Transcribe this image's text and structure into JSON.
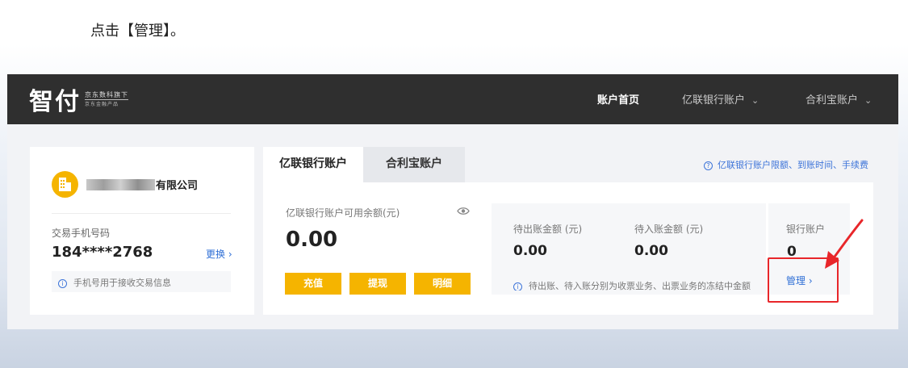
{
  "instruction": "点击【管理】。",
  "header": {
    "logo_main": "智付",
    "logo_sub_line1": "京东数科旗下",
    "logo_sub_line2": "京东金融产品",
    "nav": [
      {
        "label": "账户首页",
        "active": true
      },
      {
        "label": "亿联银行账户",
        "has_dropdown": true
      },
      {
        "label": "合利宝账户",
        "has_dropdown": true
      }
    ]
  },
  "account": {
    "company_suffix": "有限公司",
    "phone_label": "交易手机号码",
    "phone_value": "184****2768",
    "change_label": "更换",
    "phone_note": "手机号用于接收交易信息"
  },
  "tabs": [
    {
      "label": "亿联银行账户",
      "active": true
    },
    {
      "label": "合利宝账户",
      "active": false
    }
  ],
  "limits_link": "亿联银行账户限额、到账时间、手续费",
  "balance": {
    "label": "亿联银行账户可用余额(元)",
    "value": "0.00",
    "buttons": [
      "充值",
      "提现",
      "明细"
    ]
  },
  "pending": {
    "outgoing_label": "待出账金额 (元)",
    "outgoing_value": "0.00",
    "incoming_label": "待入账金额 (元)",
    "incoming_value": "0.00",
    "note": "待出账、待入账分别为收票业务、出票业务的冻结中金额"
  },
  "bank_account": {
    "label": "银行账户",
    "value": "0",
    "manage_label": "管理"
  },
  "colors": {
    "accent_yellow": "#f5b400",
    "link_blue": "#2f6fd6",
    "header_bg": "#2f2f2f",
    "highlight_red": "#e8262a"
  }
}
